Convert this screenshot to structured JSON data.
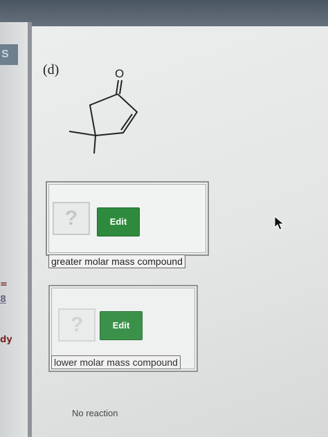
{
  "sidebar": {
    "tab_label": "S",
    "fragments": [
      "=",
      "8",
      "dy"
    ]
  },
  "question": {
    "part_label": "(d)",
    "molecule_atom_label": "O"
  },
  "answers": [
    {
      "placeholder": "?",
      "edit_label": "Edit",
      "caption": "greater molar mass compound"
    },
    {
      "placeholder": "?",
      "edit_label": "Edit",
      "caption": "lower molar mass compound"
    }
  ],
  "no_reaction_label": "No reaction",
  "colors": {
    "edit_button": "#2e8b3e",
    "sidebar_text": "#7a2a2a"
  }
}
